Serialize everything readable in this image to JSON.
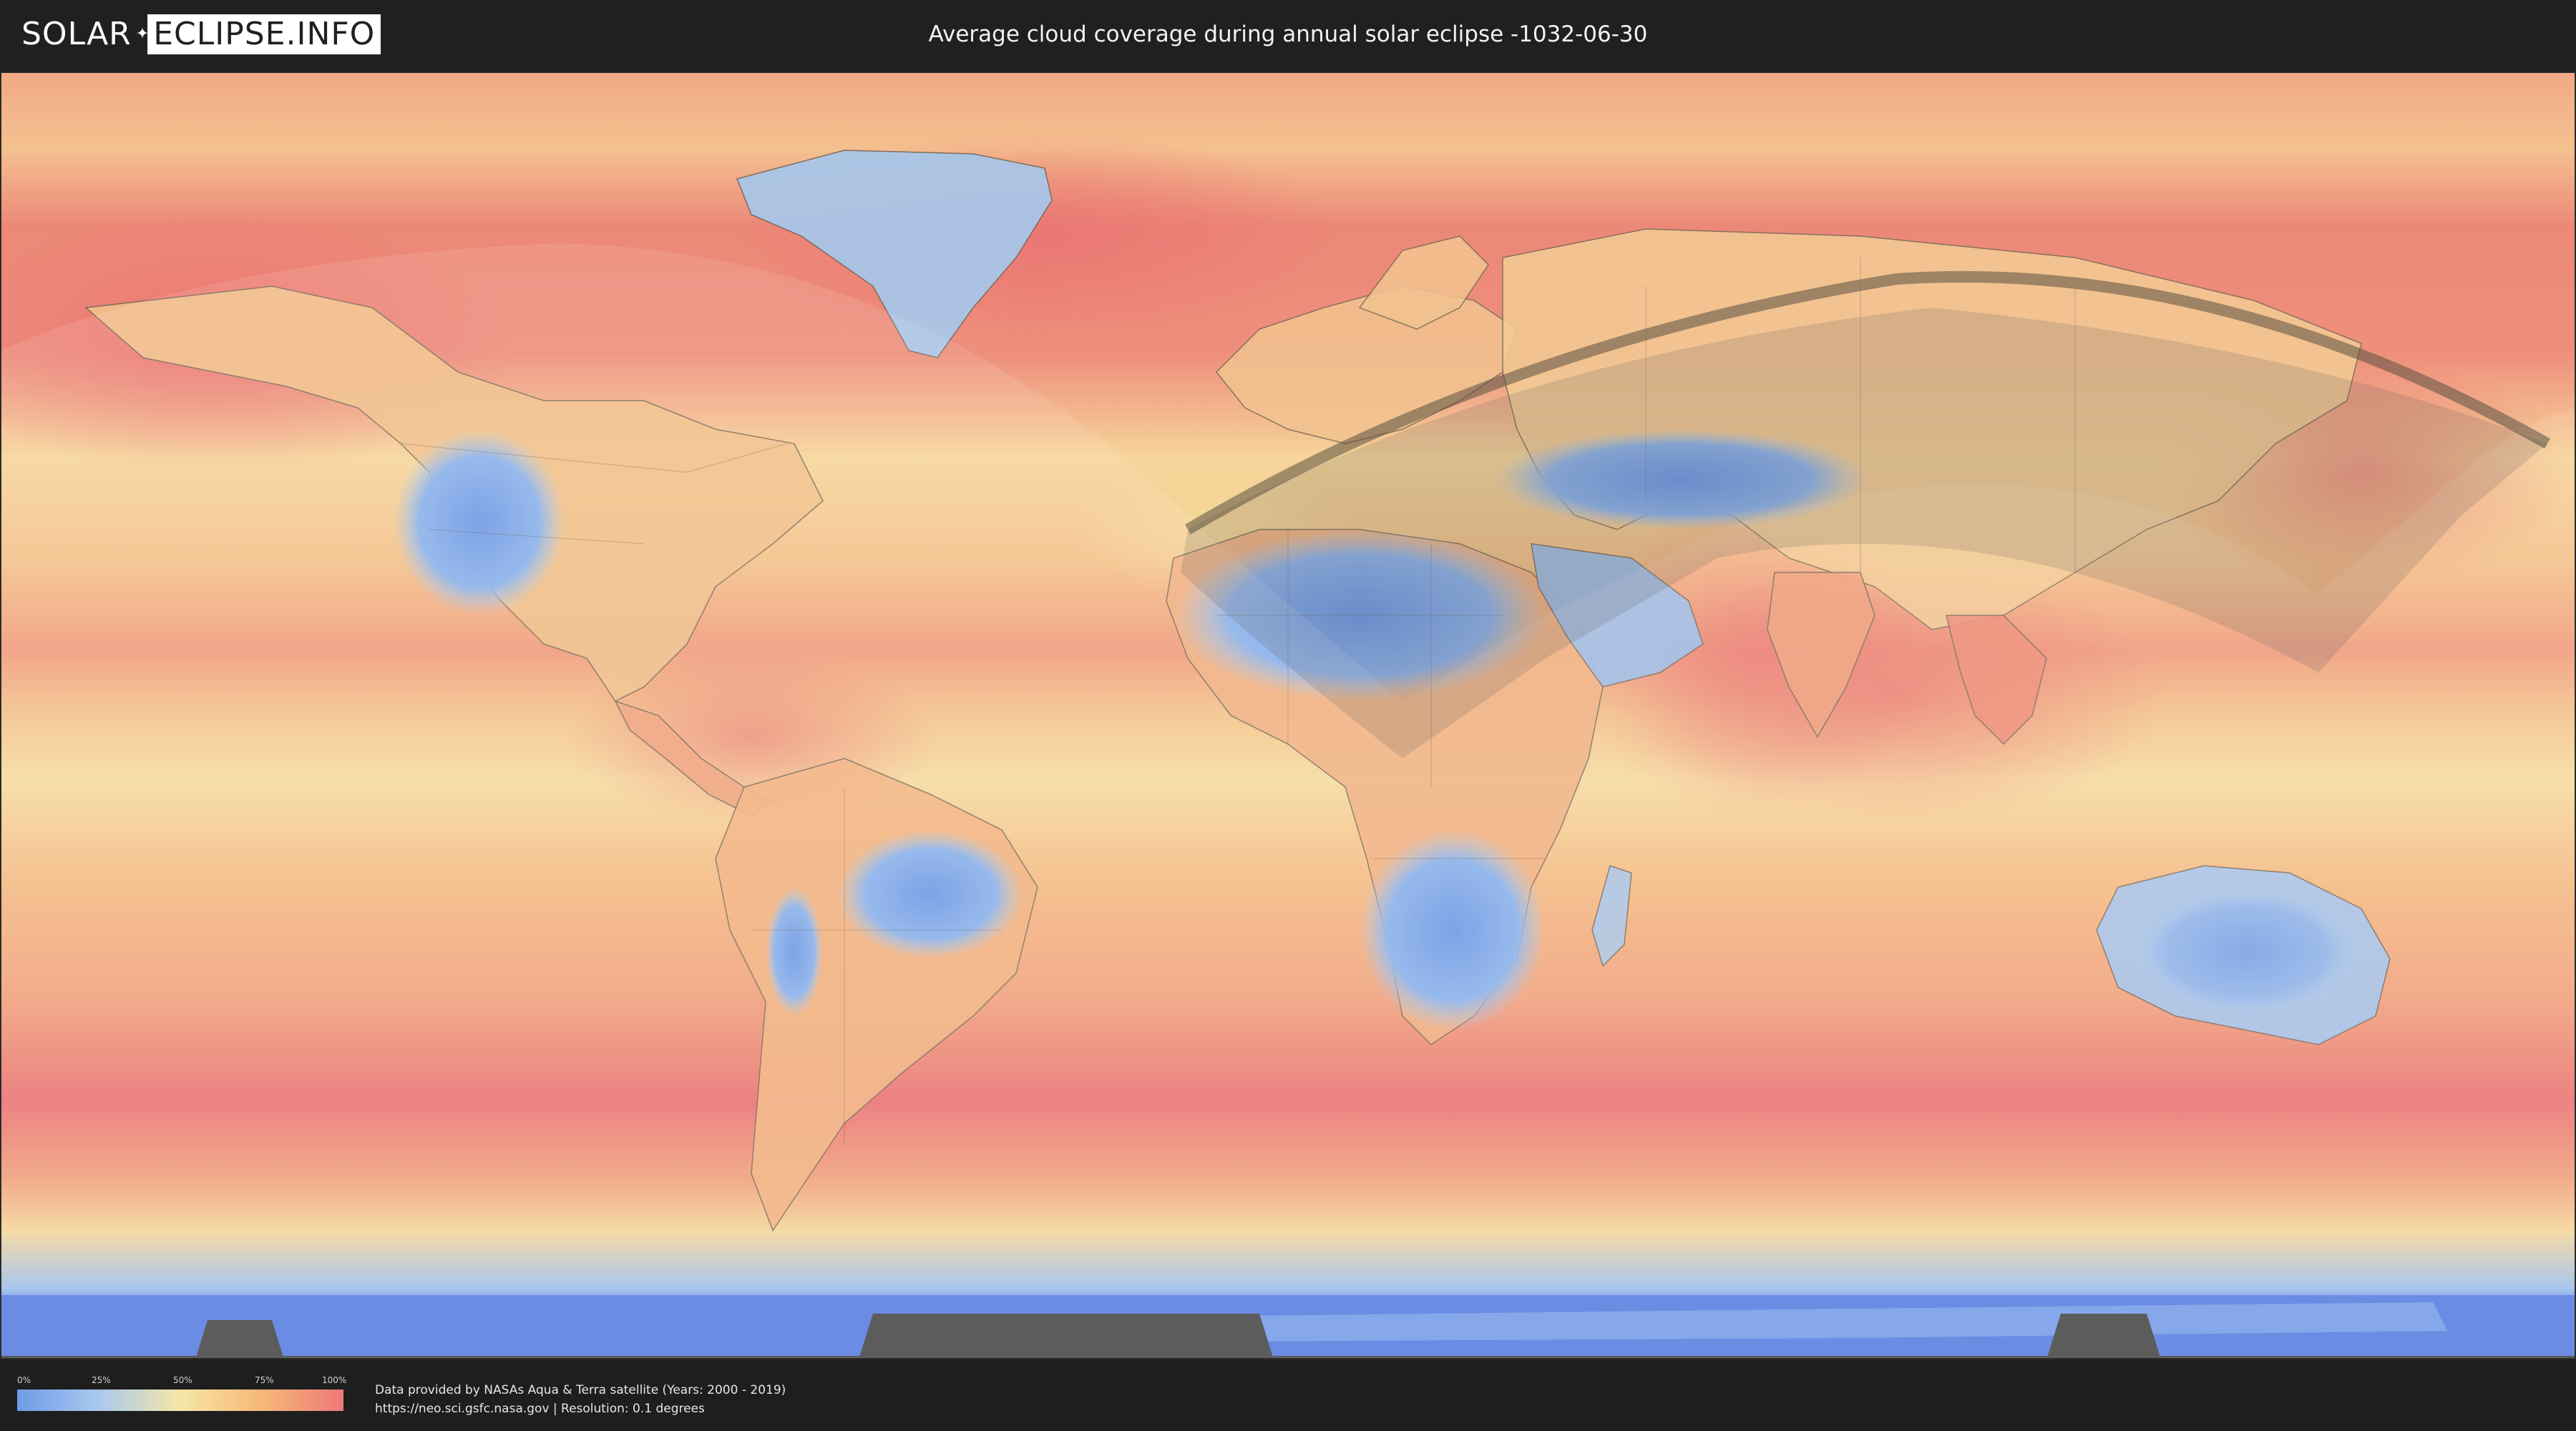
{
  "header": {
    "logo": {
      "part1": "SOLAR",
      "part2": "ECLIPSE.INFO"
    },
    "title": "Average cloud coverage during annual solar eclipse -1032-06-30"
  },
  "map": {
    "projection": "equirectangular",
    "overlay": "eclipse visibility zone and annular path",
    "colors": {
      "low_cloud": "#6f9be8",
      "mid_cloud": "#f6e6a6",
      "high_cloud": "#ee7878",
      "ice": "#5b7fe0",
      "unseen_land": "#4a4a4a"
    }
  },
  "legend": {
    "ticks": [
      "0%",
      "25%",
      "50%",
      "75%",
      "100%"
    ],
    "gradient": [
      "#6f9be8",
      "#a9c9ee",
      "#f6e6a6",
      "#f5b878",
      "#ee7878"
    ]
  },
  "footer": {
    "credit_line1": "Data provided by NASAs Aqua & Terra satellite (Years: 2000 - 2019)",
    "credit_line2": "https://neo.sci.gsfc.nasa.gov | Resolution: 0.1 degrees"
  }
}
